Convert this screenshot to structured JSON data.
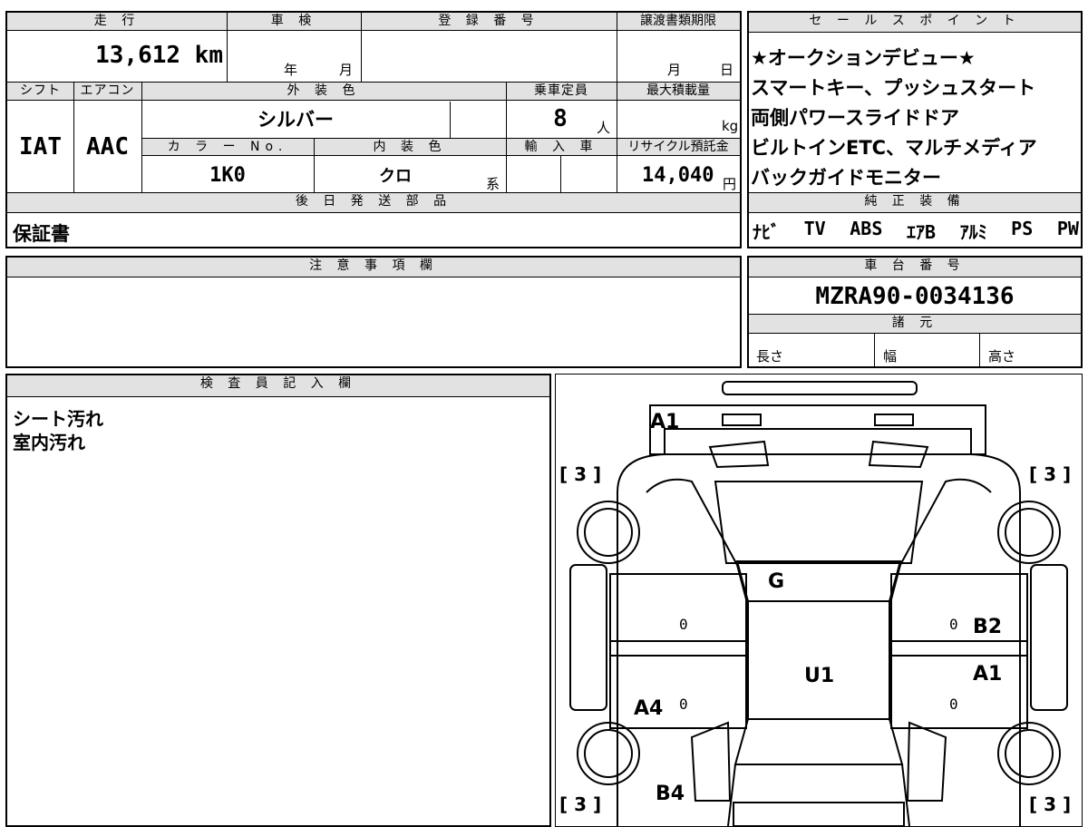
{
  "header": {
    "mileage_label": "走 行",
    "inspection_label": "車 検",
    "registration_label": "登 録 番 号",
    "transfer_deadline_label": "譲渡書類期限"
  },
  "values": {
    "mileage": "13,612 km",
    "inspection_year_unit": "年",
    "inspection_month_unit": "月",
    "transfer_month_unit": "月",
    "transfer_day_unit": "日"
  },
  "specs": {
    "shift_label": "シフト",
    "aircon_label": "エアコン",
    "exterior_color_label": "外 装 色",
    "capacity_label": "乗車定員",
    "max_load_label": "最大積載量",
    "shift": "IAT",
    "aircon": "AAC",
    "exterior_color": "シルバー",
    "capacity": "8",
    "capacity_unit": "人",
    "max_load_unit": "kg",
    "color_no_label": "カ ラ ー No.",
    "interior_color_label": "内 装 色",
    "import_label": "輸 入 車",
    "recycle_label": "リサイクル預託金",
    "color_no": "1K0",
    "interior_color": "クロ",
    "interior_suffix": "系",
    "recycle_fee": "14,040",
    "recycle_unit": "円"
  },
  "later_parts": {
    "label": "後 日 発 送 部 品",
    "value": "保証書"
  },
  "sales_points": {
    "label": "セ ー ル ス ポ イ ン ト",
    "lines": [
      "★オークションデビュー★",
      "スマートキー、プッシュスタート",
      "両側パワースライドドア",
      "ビルトインETC、マルチメディア",
      "バックガイドモニター"
    ]
  },
  "equipment": {
    "label": "純 正 装 備",
    "items": [
      "ﾅﾋﾞ",
      "TV",
      "ABS",
      "ｴｱB",
      "ｱﾙﾐ",
      "PS",
      "PW"
    ]
  },
  "notes": {
    "label": "注 意 事 項 欄",
    "value": ""
  },
  "chassis": {
    "label": "車 台 番 号",
    "value": "MZRA90-0034136"
  },
  "dimensions": {
    "label": "諸 元",
    "length_label": "長さ",
    "width_label": "幅",
    "height_label": "高さ"
  },
  "inspector": {
    "label": "検 査 員 記 入 欄",
    "lines": [
      "シート汚れ",
      "室内汚れ"
    ]
  },
  "diagram": {
    "marks": {
      "front": "A1",
      "windshield": "G",
      "right_front_door": "B2",
      "right_rear_door": "A1",
      "roof": "U1",
      "left_rear": "A4",
      "rear_left": "B4"
    },
    "tire_labels": [
      "[ 3 ]",
      "[ 3 ]",
      "[ 3 ]",
      "[ 3 ]"
    ],
    "zeros": [
      "0",
      "0",
      "0",
      "0"
    ]
  }
}
